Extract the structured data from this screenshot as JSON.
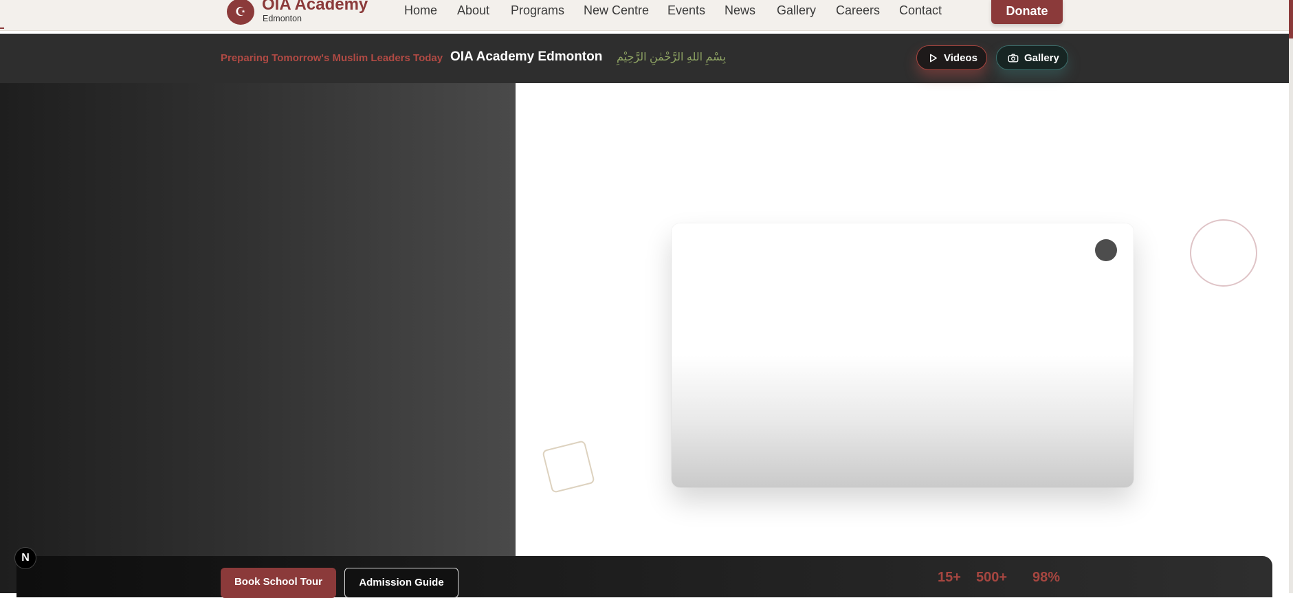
{
  "header": {
    "logo_title": "OIA Academy",
    "logo_subtitle": "Edmonton",
    "nav": [
      "Home",
      "About",
      "Programs",
      "New Centre",
      "Events",
      "News",
      "Gallery",
      "Careers",
      "Contact"
    ],
    "donate_label": "Donate"
  },
  "ribbon": {
    "tagline": "Preparing Tomorrow's Muslim Leaders Today",
    "title": "OIA Academy Edmonton",
    "bismillah": "بِسْمِ اللهِ الرَّحْمٰنِ الرَّحِيْمِ",
    "videos_label": "Videos",
    "gallery_label": "Gallery"
  },
  "bottom": {
    "tour_label": "Book School Tour",
    "guide_label": "Admission Guide",
    "stats": [
      "15+",
      "500+",
      "98%"
    ],
    "badge": "N"
  },
  "colors": {
    "brand": "#8b3a3a",
    "ribbon_bg": "#2e2e2e",
    "arabic_text": "#8ea363"
  }
}
